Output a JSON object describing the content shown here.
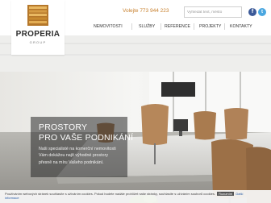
{
  "brand": {
    "name": "PROPERIA",
    "tagline": "GROUP",
    "color": "#c8862f"
  },
  "header": {
    "phone": "Volejte 773 944 223",
    "search_placeholder": "Vyhledat text, město",
    "social": [
      {
        "name": "facebook",
        "glyph": "f",
        "color": "#3b5998"
      },
      {
        "name": "twitter",
        "glyph": "t",
        "color": "#4ba7e0"
      }
    ]
  },
  "nav": {
    "items": [
      {
        "label": "NEMOVITOSTI"
      },
      {
        "label": "SLUŽBY"
      },
      {
        "label": "REFERENCE"
      },
      {
        "label": "PROJEKTY"
      },
      {
        "label": "KONTAKTY"
      }
    ]
  },
  "hero": {
    "title_line1": "PROSTORY",
    "title_line2": "PRO VAŠE PODNIKÁNÍ",
    "description": "Naši specialisté na komerční nemovitosti Vám dokážou najít výhodné prostory přesně na míru Vašeho podnikání.",
    "image": "conference-room-photo"
  },
  "cookie_bar": {
    "text": "Používáním webových stránek souhlasíte s užíváním cookies. Pokud budete nadále prohlížet naše stránky, souhlasíte s užíváním souborů cookies.",
    "button_label": "Rozumím",
    "link_label": "Další informace"
  }
}
